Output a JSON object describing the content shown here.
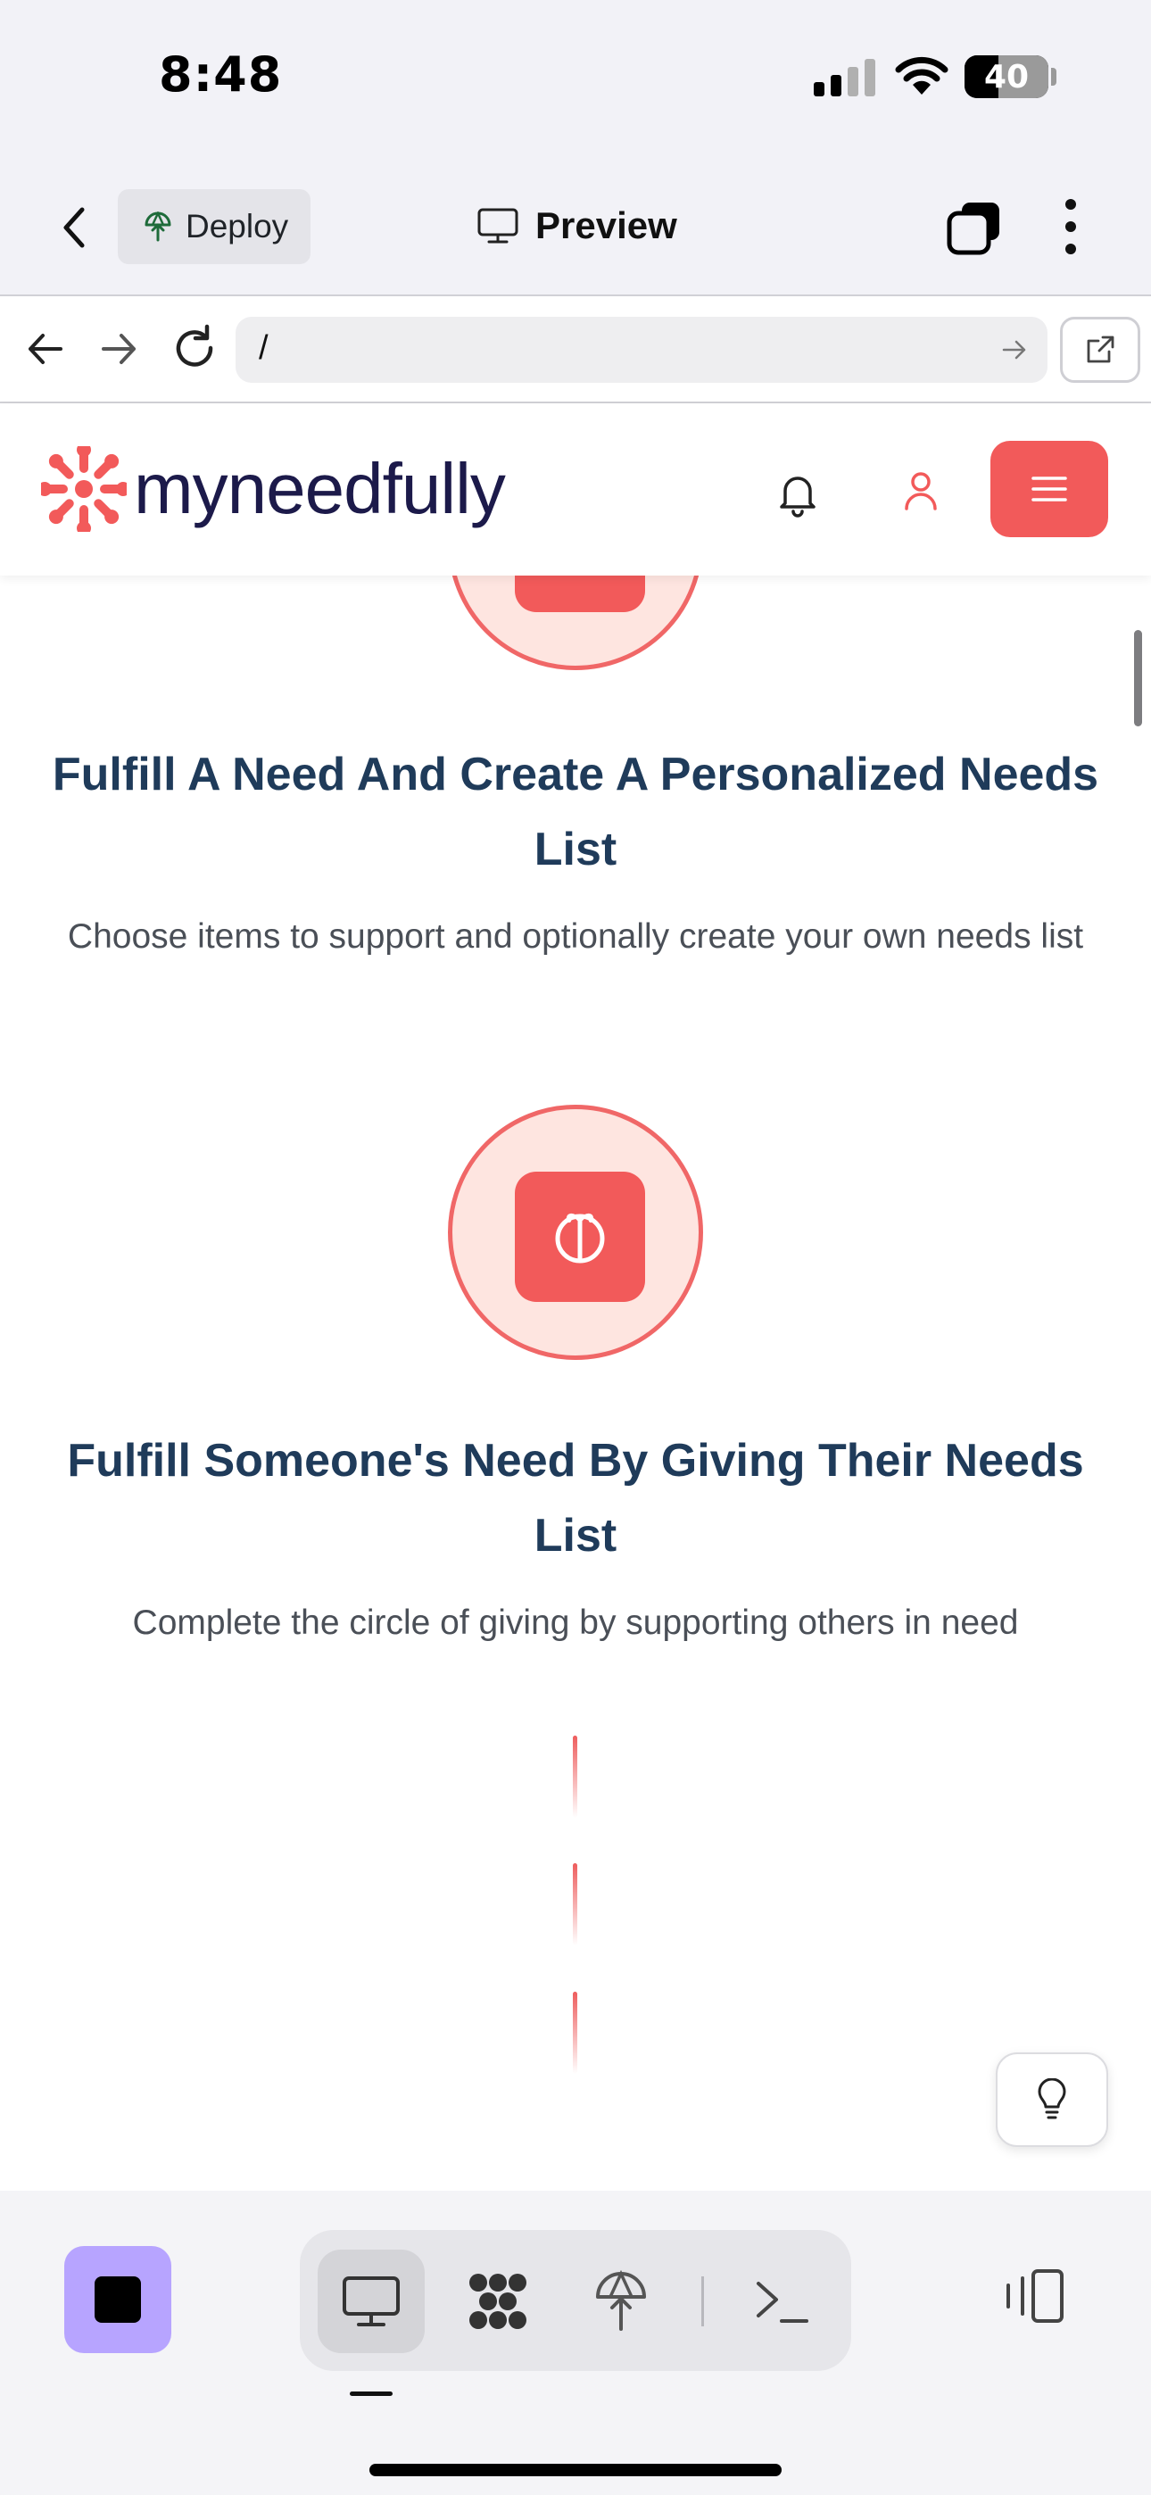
{
  "status_bar": {
    "time": "8:48",
    "battery_level": "40",
    "battery_fraction": 0.4,
    "icons": [
      "signal-icon",
      "wifi-icon",
      "battery-icon"
    ]
  },
  "app_header": {
    "deploy_label": "Deploy",
    "title": "Preview",
    "icons": [
      "chevron-left-icon",
      "deploy-icon",
      "monitor-icon",
      "tabs-icon",
      "more-vertical-icon"
    ]
  },
  "browser": {
    "url": "/",
    "icons": [
      "arrow-left-icon",
      "arrow-right-icon",
      "reload-icon",
      "go-arrow-icon",
      "external-link-icon"
    ]
  },
  "site": {
    "brand": "myneedfully",
    "brand_color": "#f25a5a",
    "text_color": "#1c1a4a",
    "icons": [
      "logo-icon",
      "bell-icon",
      "user-icon",
      "hamburger-menu-icon"
    ]
  },
  "steps": [
    {
      "title": "Fulfill A Need And Create A Personalized Needs List",
      "description": "Choose items to support and optionally create your own needs list"
    },
    {
      "title": "Fulfill Someone's Need By Giving Their Needs List",
      "description": "Complete the circle of giving by supporting others in need",
      "icon": "gift-circle-icon"
    }
  ],
  "toolbar": {
    "accent": "#b7a4ff",
    "icons": [
      "stop-icon",
      "monitor-icon",
      "assets-icon",
      "deploy-icon",
      "terminal-icon",
      "layout-toggle-icon",
      "lightbulb-icon"
    ]
  }
}
